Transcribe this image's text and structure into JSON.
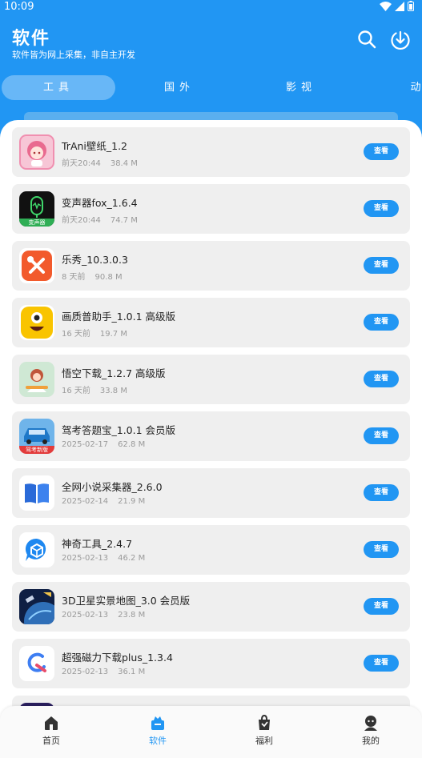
{
  "status": {
    "time": "10:09"
  },
  "header": {
    "title": "软件",
    "subtitle": "软件皆为网上采集，非自主开发"
  },
  "tabs": [
    {
      "label": "工具",
      "active": true
    },
    {
      "label": "国外",
      "active": false
    },
    {
      "label": "影视",
      "active": false
    },
    {
      "label": "动",
      "active": false
    }
  ],
  "apps": [
    {
      "name": "TrAni壁纸_1.2",
      "time": "前天20:44",
      "size": "38.4 M",
      "icon": "anime-girl-icon",
      "action": "查看"
    },
    {
      "name": "变声器fox_1.6.4",
      "time": "前天20:44",
      "size": "74.7 M",
      "icon": "microphone-icon",
      "action": "查看",
      "icon_text": "变声器"
    },
    {
      "name": "乐秀_10.3.0.3",
      "time": "8 天前",
      "size": "90.8 M",
      "icon": "tools-icon",
      "action": "查看"
    },
    {
      "name": "画质普助手_1.0.1 高级版",
      "time": "16 天前",
      "size": "19.7 M",
      "icon": "yellow-monster-icon",
      "action": "查看"
    },
    {
      "name": "悟空下载_1.2.7 高级版",
      "time": "16 天前",
      "size": "33.8 M",
      "icon": "monkey-king-icon",
      "action": "查看"
    },
    {
      "name": "驾考答题宝_1.0.1 会员版",
      "time": "2025-02-17",
      "size": "62.8 M",
      "icon": "car-icon",
      "action": "查看",
      "icon_text": "驾考新版"
    },
    {
      "name": "全网小说采集器_2.6.0",
      "time": "2025-02-14",
      "size": "21.9 M",
      "icon": "book-icon",
      "action": "查看"
    },
    {
      "name": "神奇工具_2.4.7",
      "time": "2025-02-13",
      "size": "46.2 M",
      "icon": "cube-chat-icon",
      "action": "查看"
    },
    {
      "name": "3D卫星实景地图_3.0 会员版",
      "time": "2025-02-13",
      "size": "23.8 M",
      "icon": "satellite-earth-icon",
      "action": "查看"
    },
    {
      "name": "超强磁力下载plus_1.3.4",
      "time": "2025-02-13",
      "size": "36.1 M",
      "icon": "magnet-download-icon",
      "action": "查看"
    },
    {
      "name": "",
      "time": "",
      "size": "",
      "icon": "partial-app-icon",
      "action": ""
    }
  ],
  "nav": [
    {
      "label": "首页",
      "icon": "home-icon",
      "active": false
    },
    {
      "label": "软件",
      "icon": "software-icon",
      "active": true
    },
    {
      "label": "福利",
      "icon": "gift-bag-icon",
      "active": false
    },
    {
      "label": "我的",
      "icon": "profile-icon",
      "active": false
    }
  ],
  "colors": {
    "primary": "#2196F3",
    "card": "#efefef",
    "meta": "#9a9a9a"
  }
}
